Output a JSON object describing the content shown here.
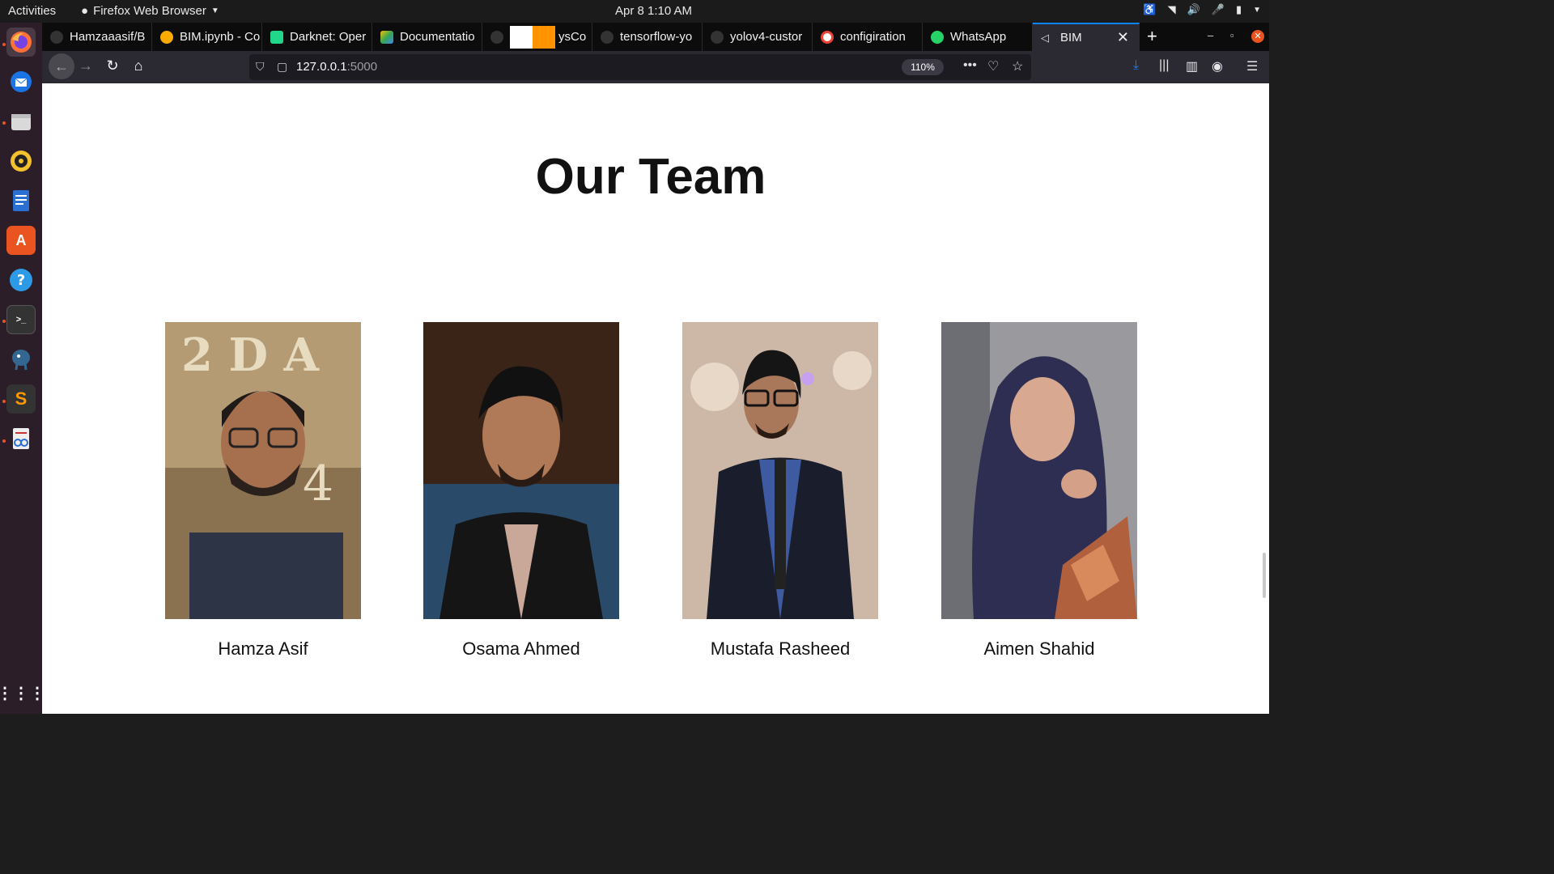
{
  "system": {
    "activities": "Activities",
    "app_name": "Firefox Web Browser",
    "clock": "Apr 8   1:10 AM"
  },
  "tabs": [
    {
      "label": "Hamzaaasif/B"
    },
    {
      "label": "BIM.ipynb - Co"
    },
    {
      "label": "Darknet: Oper"
    },
    {
      "label": "Documentatio"
    },
    {
      "label": "ysCo"
    },
    {
      "label": "tensorflow-yo"
    },
    {
      "label": "yolov4-custor"
    },
    {
      "label": "configiration"
    },
    {
      "label": "WhatsApp"
    },
    {
      "label": "BIM"
    }
  ],
  "urlbar": {
    "host": "127.0.0.1",
    "port": ":5000",
    "zoom": "110%"
  },
  "page": {
    "title": "Our Team",
    "members": [
      {
        "name": "Hamza Asif"
      },
      {
        "name": "Osama Ahmed"
      },
      {
        "name": "Mustafa Rasheed"
      },
      {
        "name": "Aimen Shahid"
      }
    ]
  },
  "colors": {
    "accent": "#0a84ff",
    "ubuntu_orange": "#e95420"
  }
}
